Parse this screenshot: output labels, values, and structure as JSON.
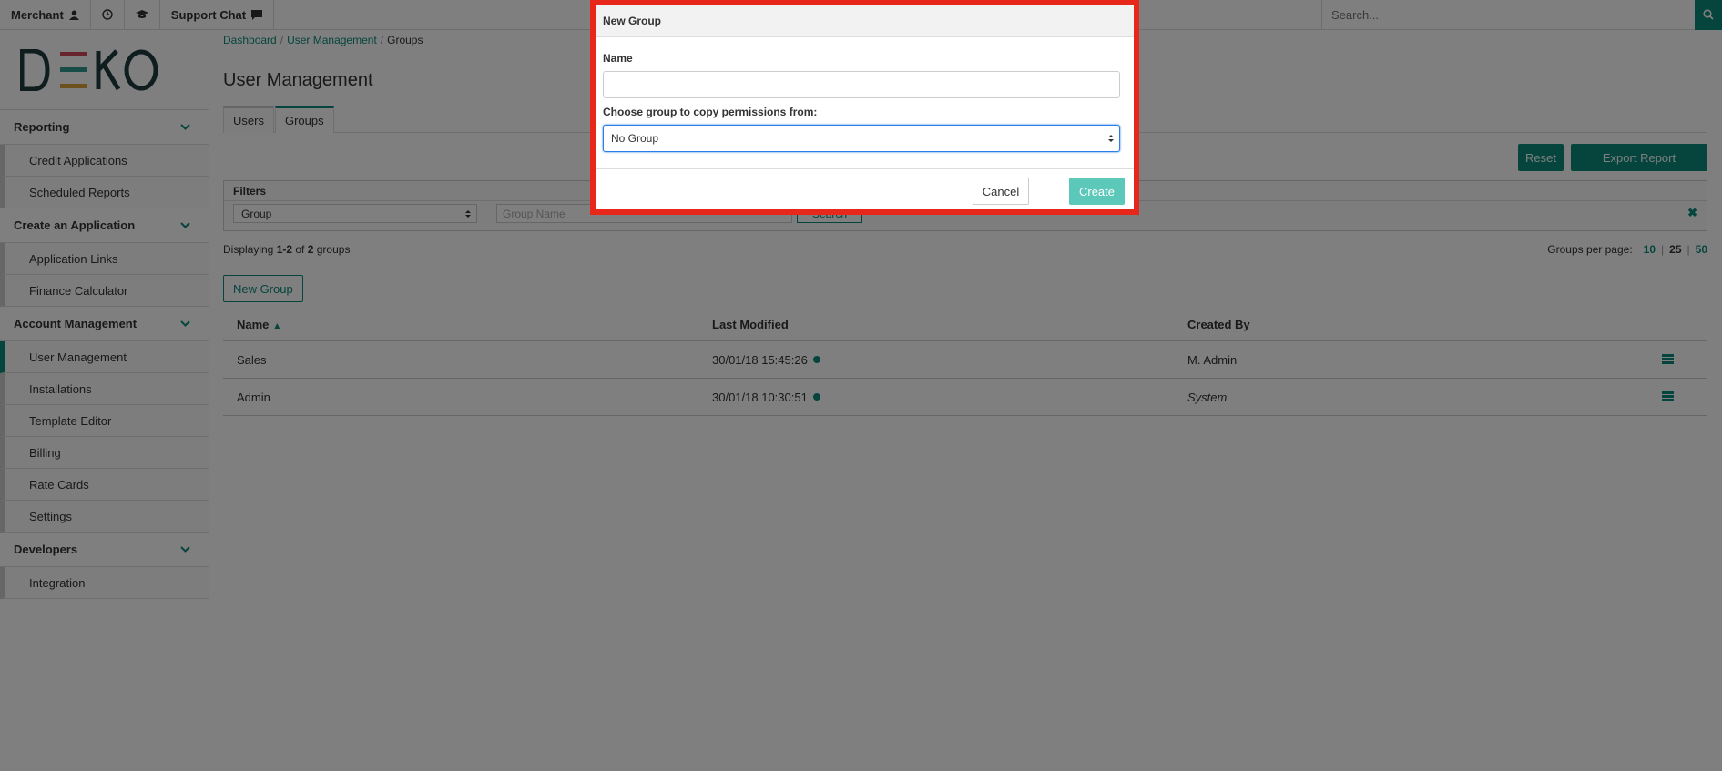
{
  "topbar": {
    "merchant_label": "Merchant",
    "support_label": "Support Chat",
    "search_placeholder": "Search..."
  },
  "sidebar": {
    "logo_text": "DEKO",
    "sections": [
      {
        "label": "Reporting",
        "items": [
          "Credit Applications",
          "Scheduled Reports"
        ]
      },
      {
        "label": "Create an Application",
        "items": [
          "Application Links",
          "Finance Calculator"
        ]
      },
      {
        "label": "Account Management",
        "items": [
          "User Management",
          "Installations",
          "Template Editor",
          "Billing",
          "Rate Cards",
          "Settings"
        ]
      },
      {
        "label": "Developers",
        "items": [
          "Integration"
        ]
      }
    ],
    "active_item": "User Management"
  },
  "breadcrumb": {
    "dashboard": "Dashboard",
    "user_management": "User Management",
    "groups": "Groups",
    "sep": "/"
  },
  "page": {
    "title": "User Management",
    "tabs": [
      "Users",
      "Groups"
    ],
    "reset_label": "Reset",
    "export_label": "Export Report"
  },
  "filters": {
    "heading": "Filters",
    "select_value": "Group",
    "input_placeholder": "Group Name",
    "search_label": "Search",
    "clear_symbol": "✖"
  },
  "listing": {
    "display_prefix": "Displaying ",
    "display_range": "1-2",
    "display_of": " of ",
    "display_total": "2",
    "display_suffix": " groups",
    "per_page_label": "Groups per page:",
    "per_page_options": [
      "10",
      "25",
      "50"
    ],
    "new_group_label": "New Group"
  },
  "table": {
    "headers": [
      "Name",
      "Last Modified",
      "Created By"
    ],
    "rows": [
      {
        "name": "Sales",
        "modified": "30/01/18 15:45:26",
        "created_by": "M. Admin"
      },
      {
        "name": "Admin",
        "modified": "30/01/18 10:30:51",
        "created_by": "System"
      }
    ]
  },
  "modal": {
    "title": "New Group",
    "name_label": "Name",
    "copy_label": "Choose group to copy permissions from:",
    "copy_value": "No Group",
    "cancel_label": "Cancel",
    "create_label": "Create"
  },
  "colors": {
    "accent": "#0a8a7a",
    "highlight": "#e8271b",
    "create_button": "#5bc8b9"
  }
}
